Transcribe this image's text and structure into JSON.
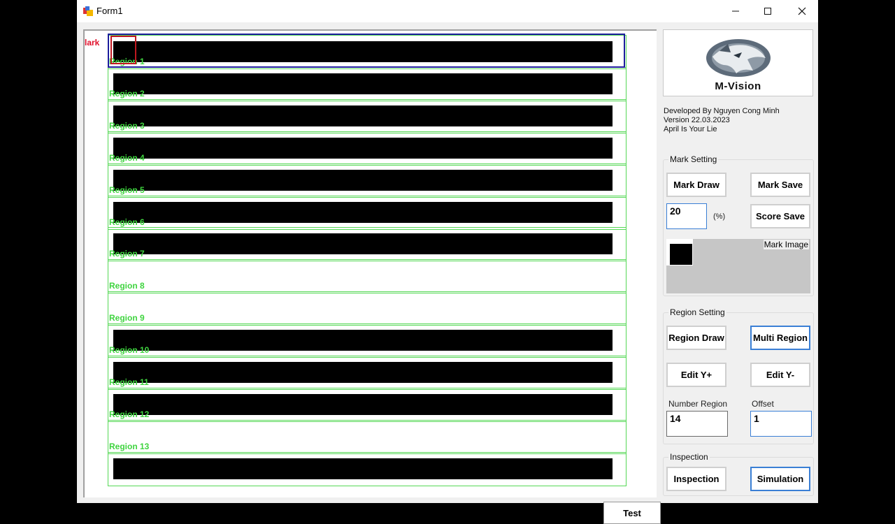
{
  "window": {
    "title": "Form1",
    "controls": {
      "minimize": "—",
      "maximize": "☐",
      "close": "✕"
    }
  },
  "canvas": {
    "mark_label": "lark",
    "regions": [
      {
        "label": "Region 1"
      },
      {
        "label": "Region 2"
      },
      {
        "label": "Region 3"
      },
      {
        "label": "Region 4"
      },
      {
        "label": "Region 5"
      },
      {
        "label": "Region 6"
      },
      {
        "label": "Region 7"
      },
      {
        "label": "Region 8"
      },
      {
        "label": "Region 9"
      },
      {
        "label": "Region 10"
      },
      {
        "label": "Region 11"
      },
      {
        "label": "Region 12"
      },
      {
        "label": "Region 13"
      },
      {
        "label": ""
      }
    ],
    "test_label": "Test"
  },
  "logo": {
    "text": "M-Vision"
  },
  "info": {
    "line1": "Developed By Nguyen Cong Minh",
    "line2": "Version 22.03.2023",
    "line3": "April Is Your Lie"
  },
  "mark_setting": {
    "title": "Mark Setting",
    "mark_draw": "Mark Draw",
    "mark_save": "Mark Save",
    "percent_value": "20",
    "percent_unit": "(%)",
    "score_save": "Score Save",
    "mark_image_label": "Mark Image"
  },
  "region_setting": {
    "title": "Region Setting",
    "region_draw": "Region Draw",
    "multi_region": "Multi Region",
    "edit_y_plus": "Edit Y+",
    "edit_y_minus": "Edit Y-",
    "number_region_label": "Number Region",
    "number_region_value": "14",
    "offset_label": "Offset",
    "offset_value": "1"
  },
  "inspection": {
    "title": "Inspection",
    "inspection_btn": "Inspection",
    "simulation_btn": "Simulation"
  },
  "colors": {
    "region_green": "#55d855",
    "label_green": "#3fd43f",
    "mark_red": "#e0102b",
    "frame_blue": "#1d1d9c",
    "focus_blue": "#3a7fd5"
  }
}
